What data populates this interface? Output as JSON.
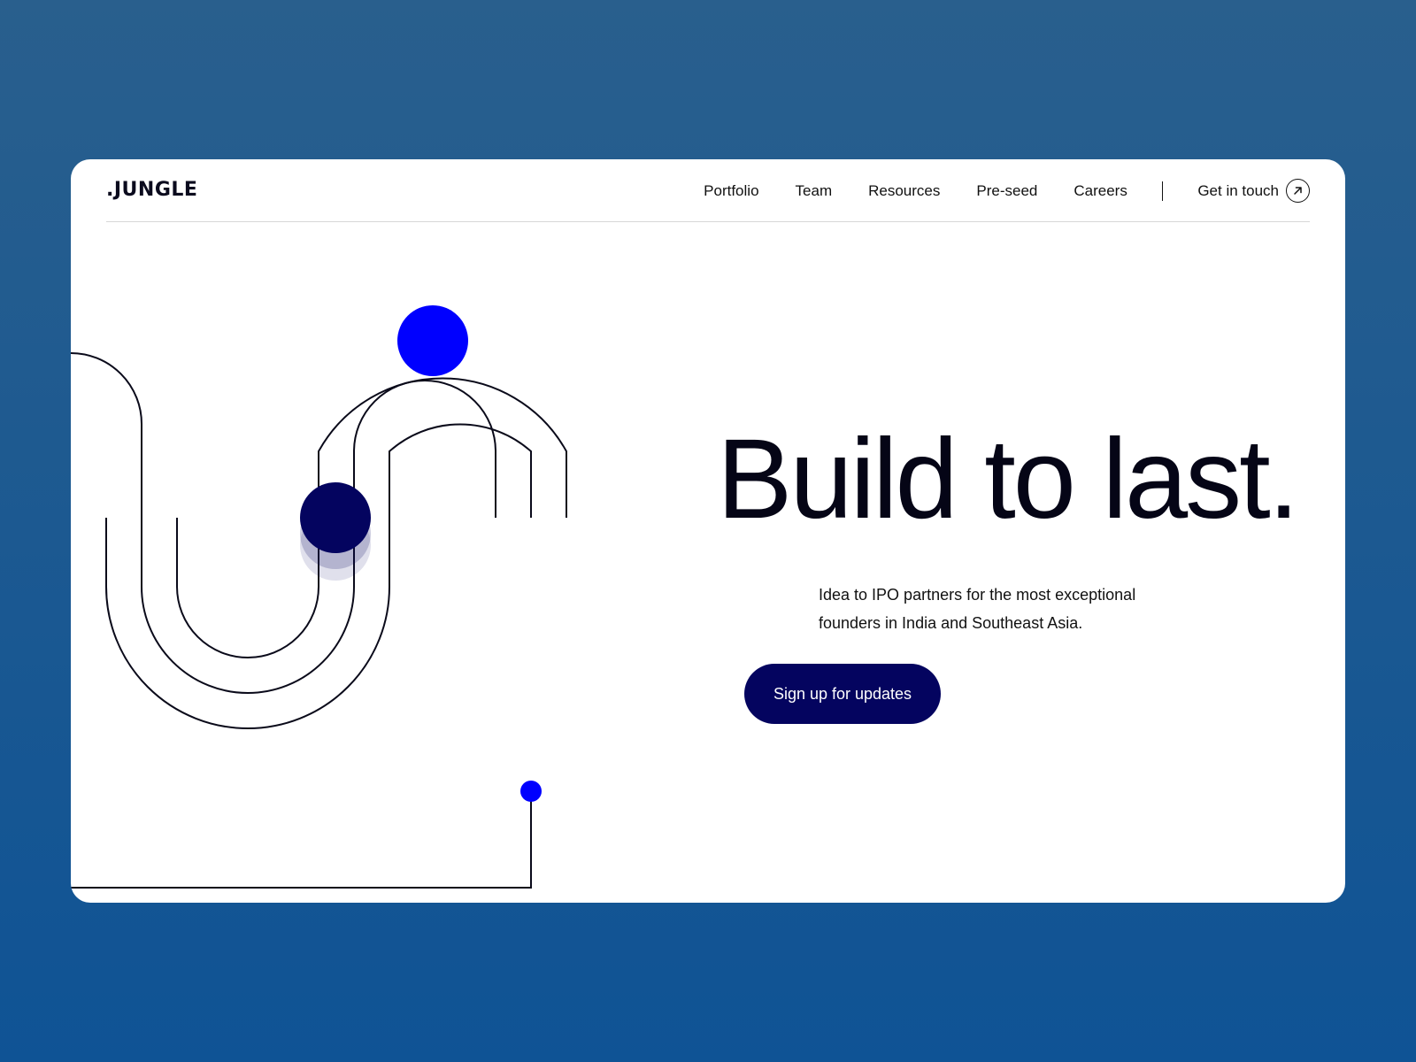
{
  "brand": {
    "logo_text": ".JUNGLE"
  },
  "nav": {
    "items": [
      {
        "label": "Portfolio"
      },
      {
        "label": "Team"
      },
      {
        "label": "Resources"
      },
      {
        "label": "Pre-seed"
      },
      {
        "label": "Careers"
      }
    ],
    "contact_label": "Get in touch",
    "contact_icon": "arrow-up-right-circle-icon"
  },
  "hero": {
    "headline": "Build to last.",
    "subtext": "Idea to IPO partners for the most exceptional founders in India and Southeast Asia.",
    "cta_label": "Sign up for updates"
  },
  "colors": {
    "accent_blue": "#0000ff",
    "navy": "#04045f",
    "background_gradient_top": "#295f8d",
    "background_gradient_bottom": "#0f5395"
  }
}
